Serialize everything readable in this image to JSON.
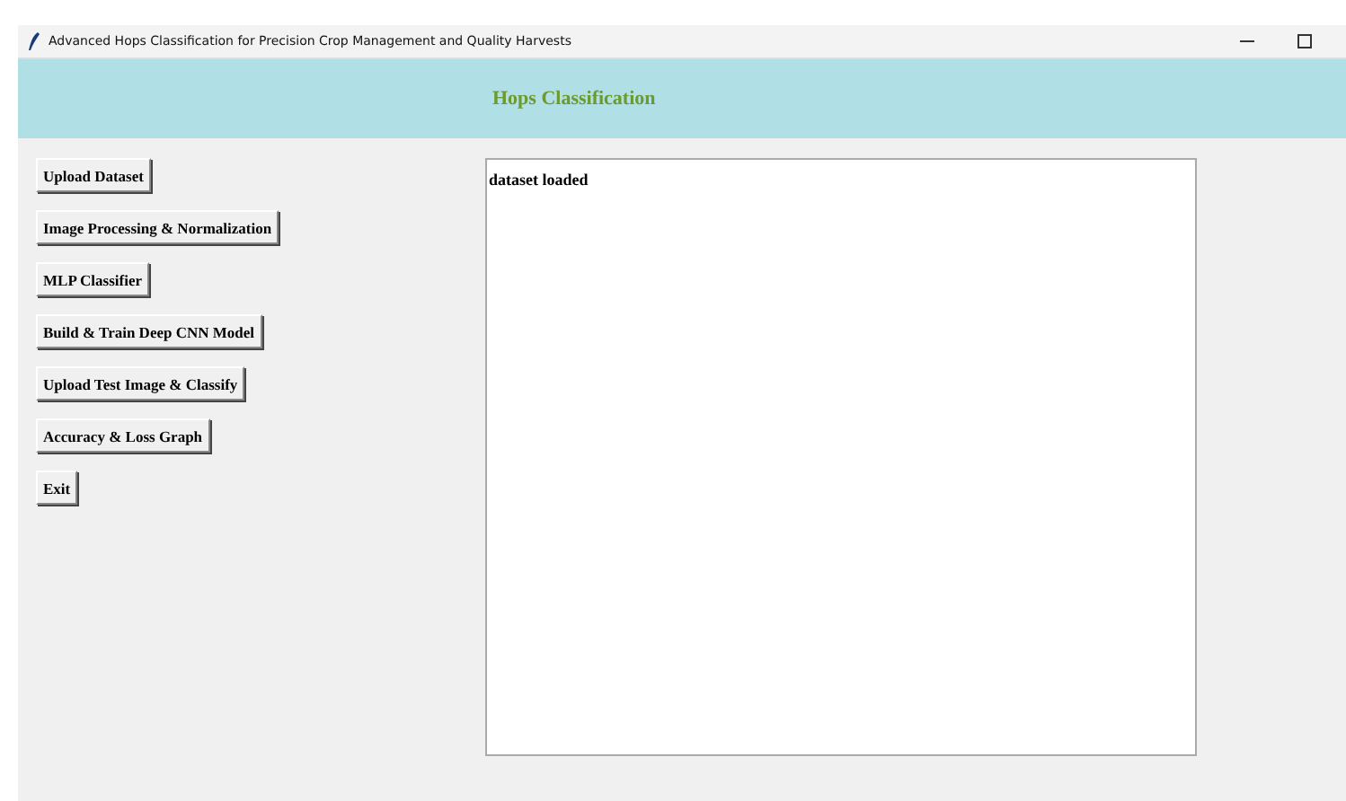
{
  "window": {
    "title": "Advanced Hops Classification for Precision Crop Management and Quality Harvests"
  },
  "header": {
    "title": "Hops Classification"
  },
  "buttons": [
    "Upload Dataset",
    "Image Processing & Normalization",
    "MLP Classifier",
    "Build & Train Deep CNN Model",
    "Upload Test Image & Classify",
    "Accuracy & Loss Graph",
    "Exit"
  ],
  "output": {
    "text": "dataset loaded"
  }
}
